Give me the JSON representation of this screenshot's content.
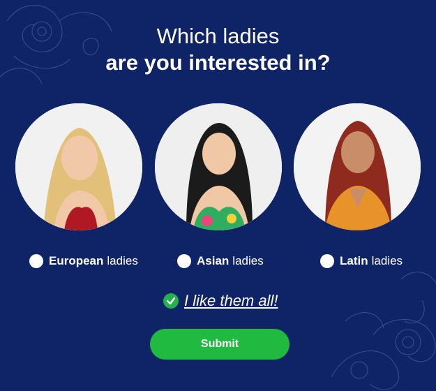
{
  "heading": {
    "line1": "Which ladies",
    "line2": "are you interested in?"
  },
  "options": [
    {
      "strong": "European",
      "rest": "ladies",
      "checked": false
    },
    {
      "strong": "Asian",
      "rest": "ladies",
      "checked": false
    },
    {
      "strong": "Latin",
      "rest": "ladies",
      "checked": false
    }
  ],
  "like_all": {
    "label": "I like them all!",
    "checked": true
  },
  "submit": {
    "label": "Submit"
  },
  "colors": {
    "background": "#0f2466",
    "accent_green": "#1fba3f",
    "check_green": "#22b14c",
    "text": "#ffffff"
  },
  "icons": [
    "floral-decoration-icon",
    "checkmark-icon",
    "radio-icon"
  ]
}
